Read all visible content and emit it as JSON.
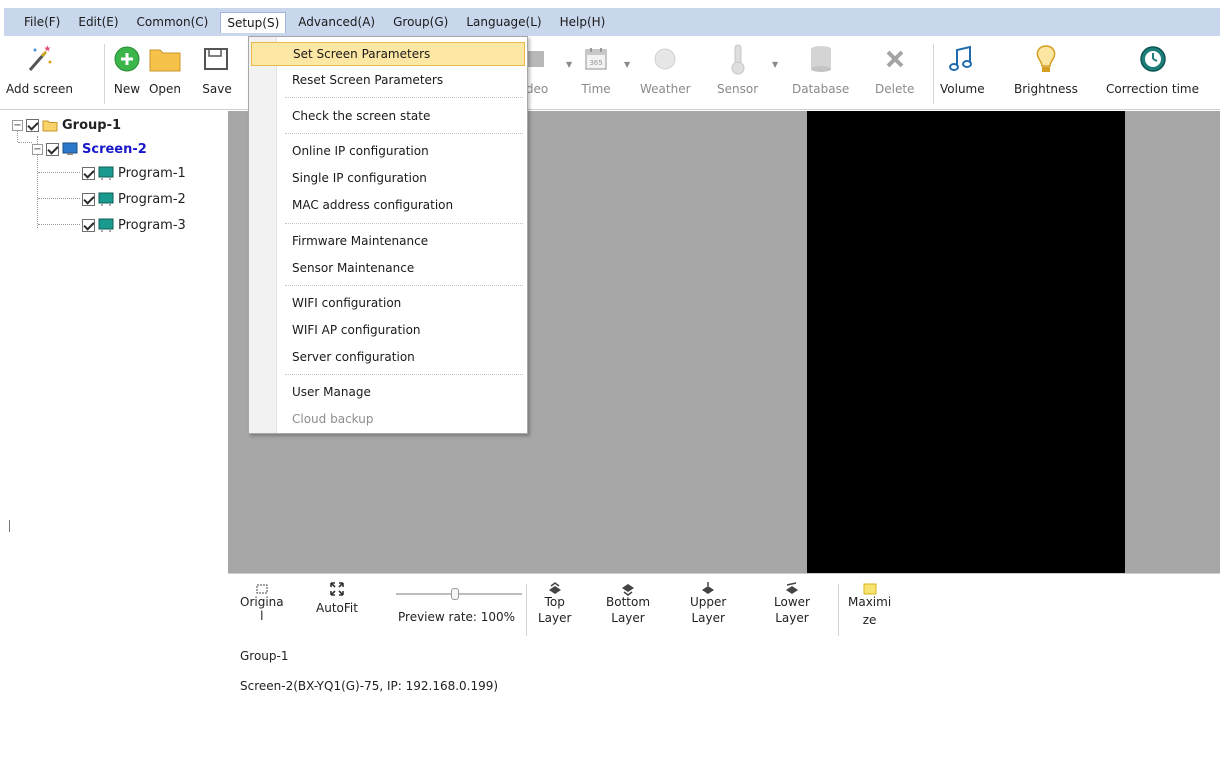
{
  "menubar": {
    "items": [
      {
        "label": "File(F)"
      },
      {
        "label": "Edit(E)"
      },
      {
        "label": "Common(C)"
      },
      {
        "label": "Setup(S)"
      },
      {
        "label": "Advanced(A)"
      },
      {
        "label": "Group(G)"
      },
      {
        "label": "Language(L)"
      },
      {
        "label": "Help(H)"
      }
    ]
  },
  "toolbar": {
    "add_screen": "Add screen",
    "new": "New",
    "open": "Open",
    "save": "Save",
    "video": "deo",
    "time": "Time",
    "weather": "Weather",
    "sensor": "Sensor",
    "database": "Database",
    "delete": "Delete",
    "volume": "Volume",
    "brightness": "Brightness",
    "correction_time": "Correction time"
  },
  "setup_menu": {
    "items": [
      "Set Screen Parameters",
      "Reset Screen Parameters",
      "Check the screen state",
      "Online IP configuration",
      "Single IP configuration",
      "MAC address configuration",
      "Firmware Maintenance",
      "Sensor Maintenance",
      "WIFI configuration",
      "WIFI AP configuration",
      "Server configuration",
      "User Manage",
      "Cloud backup"
    ]
  },
  "tree": {
    "group": "Group-1",
    "screen": "Screen-2",
    "programs": [
      "Program-1",
      "Program-2",
      "Program-3"
    ]
  },
  "bottom": {
    "original_a": "Origina",
    "original_b": "l",
    "autofit": "AutoFit",
    "preview_rate": "Preview rate: 100%",
    "top_a": "Top",
    "top_b": "Layer",
    "bottom_a": "Bottom",
    "bottom_b": "Layer",
    "upper_a": "Upper",
    "upper_b": "Layer",
    "lower_a": "Lower",
    "lower_b": "Layer",
    "maximize_a": "Maximi",
    "maximize_b": "ze",
    "group_info": "Group-1",
    "screen_info": "Screen-2(BX-YQ1(G)-75, IP: 192.168.0.199)"
  },
  "colors": {
    "menubar_bg": "#c9d7ed",
    "canvas_bg": "#a7a7a7",
    "screen_bg": "#000000",
    "hover_bg": "#fde7a4",
    "screen_label": "#1818c8"
  }
}
